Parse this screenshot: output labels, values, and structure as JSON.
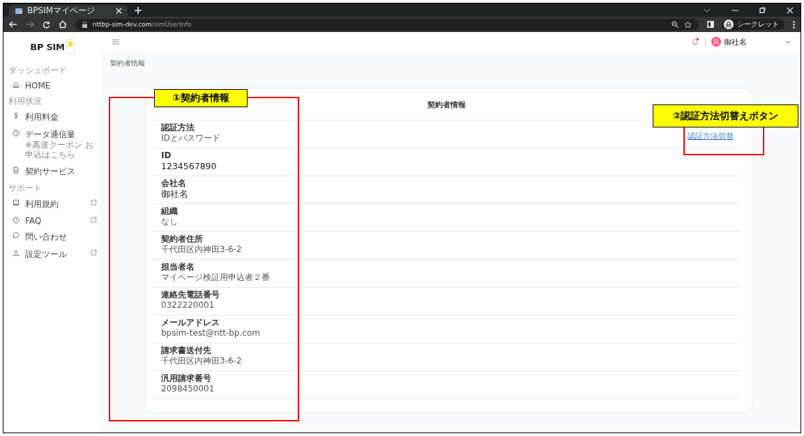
{
  "browser": {
    "tab_title": "BPSIMマイページ",
    "url_host": "nttbp-sim-dev.com",
    "url_path": "/simUserInfo",
    "profile": "シークレット"
  },
  "sidebar": {
    "logo": "BP SIM",
    "sections": [
      {
        "heading": "ダッシュボード",
        "items": [
          {
            "label": "HOME",
            "external": false
          }
        ]
      },
      {
        "heading": "利用状況",
        "items": [
          {
            "label": "利用料金",
            "external": false
          },
          {
            "label": "データ通信量",
            "note": "※高速クーポン お申込はこちら",
            "external": false
          },
          {
            "label": "契約サービス",
            "external": false
          }
        ]
      },
      {
        "heading": "サポート",
        "items": [
          {
            "label": "利用規約",
            "external": true
          },
          {
            "label": "FAQ",
            "external": true
          },
          {
            "label": "問い合わせ",
            "external": false
          },
          {
            "label": "設定ツール",
            "external": true
          }
        ]
      }
    ]
  },
  "header": {
    "notification": true,
    "user": "御社名"
  },
  "page_title": "契約者情報",
  "card": {
    "title": "契約者情報",
    "action_link": "認証方法切替",
    "fields": [
      {
        "label": "認証方法",
        "value": "IDとパスワード",
        "kind": "small"
      },
      {
        "label": "ID",
        "value": "1234567890",
        "kind": "large"
      },
      {
        "label": "会社名",
        "value": "御社名",
        "kind": "large"
      },
      {
        "label": "組織",
        "value": "なし",
        "kind": "small"
      },
      {
        "label": "契約者住所",
        "value": "千代田区内神田3-6-2",
        "kind": "small"
      },
      {
        "label": "担当者名",
        "value": "マイページ検証用申込者２番",
        "kind": "small"
      },
      {
        "label": "連絡先電話番号",
        "value": "0322220001",
        "kind": "small"
      },
      {
        "label": "メールアドレス",
        "value": "bpsim-test@ntt-bp.com",
        "kind": "small"
      },
      {
        "label": "請求書送付先",
        "value": "千代田区内神田3-6-2",
        "kind": "small"
      },
      {
        "label": "汎用請求番号",
        "value": "2098450001",
        "kind": "small"
      }
    ]
  },
  "annotations": [
    {
      "label": "①契約者情報"
    },
    {
      "label": "②認証方法切替えボタン"
    }
  ]
}
